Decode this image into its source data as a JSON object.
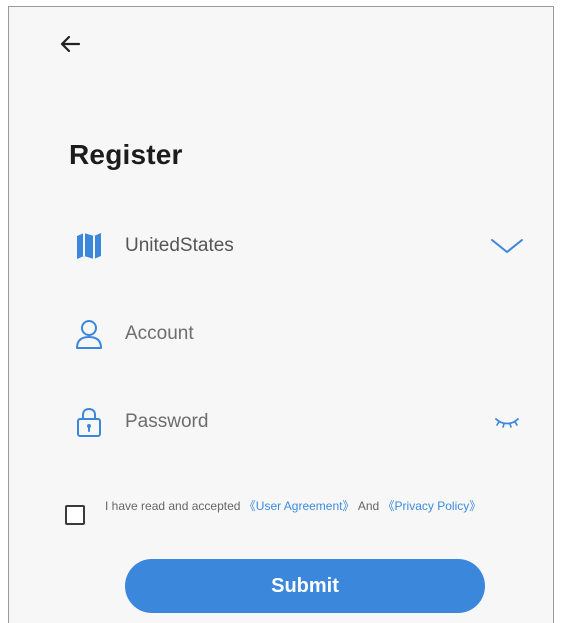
{
  "header": {
    "title": "Register"
  },
  "fields": {
    "country": {
      "value": "UnitedStates"
    },
    "account": {
      "placeholder": "Account"
    },
    "password": {
      "placeholder": "Password"
    }
  },
  "agreement": {
    "prefix": "I have read and accepted",
    "user_agreement": "《User Agreement》",
    "and": "And",
    "privacy_policy": "《Privacy Policy》"
  },
  "submit_label": "Submit",
  "icons": {
    "back": "arrow-left-icon",
    "country": "map-icon",
    "dropdown": "chevron-down-icon",
    "account": "user-icon",
    "password": "lock-icon",
    "visibility": "eye-closed-icon"
  },
  "colors": {
    "accent": "#3b87dc",
    "background": "#f7f7f7",
    "title": "#1c1c1c"
  }
}
